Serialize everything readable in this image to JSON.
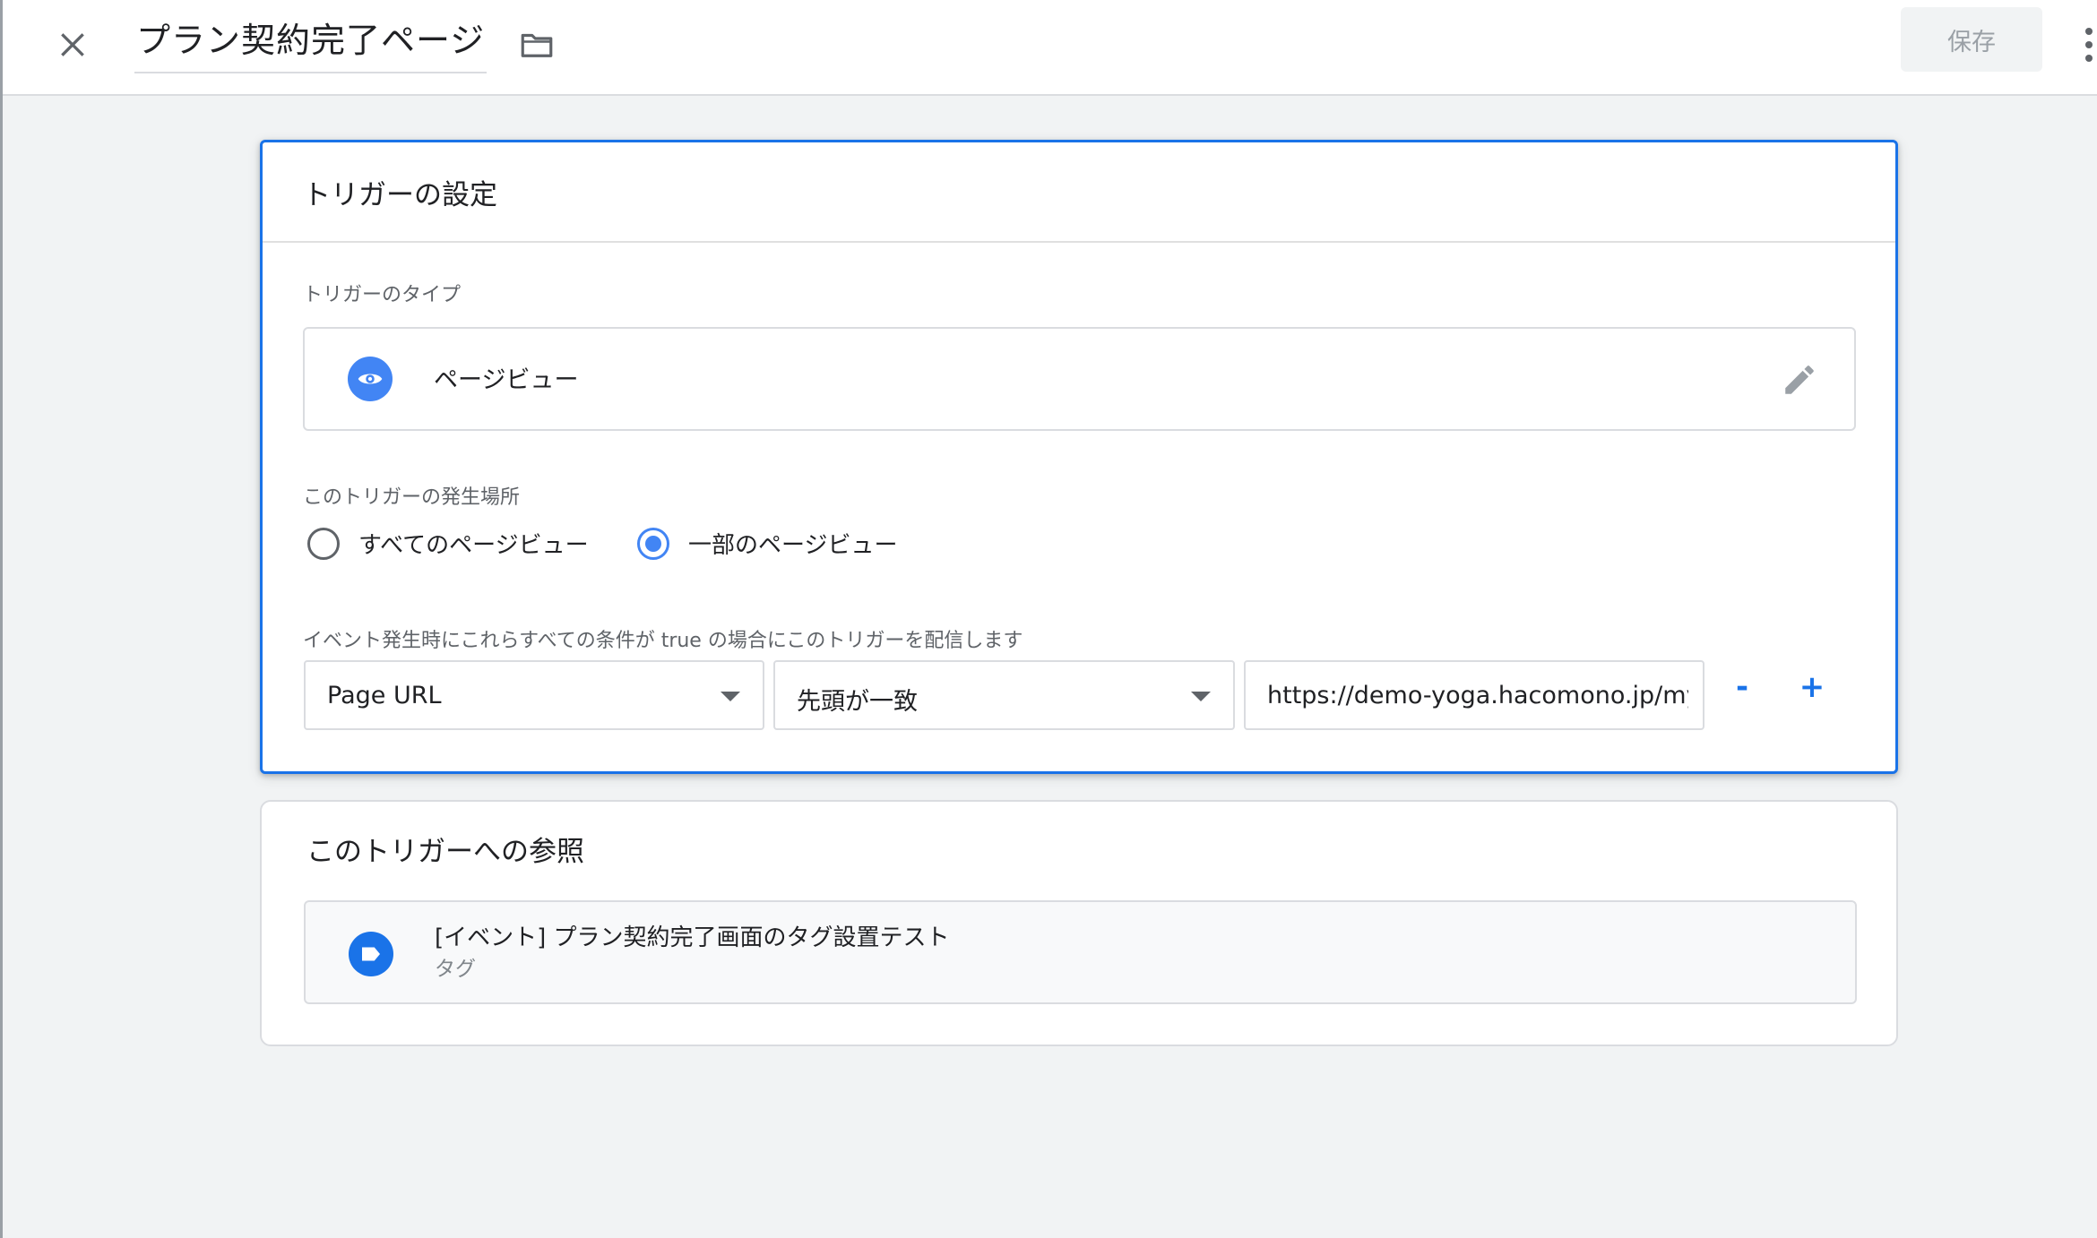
{
  "header": {
    "title": "プラン契約完了ページ",
    "save_label": "保存"
  },
  "trigger_config": {
    "card_title": "トリガーの設定",
    "type_label": "トリガーのタイプ",
    "type_name": "ページビュー",
    "fires_on_label": "このトリガーの発生場所",
    "radio_options": [
      {
        "label": "すべてのページビュー",
        "selected": false
      },
      {
        "label": "一部のページビュー",
        "selected": true
      }
    ],
    "condition_label": "イベント発生時にこれらすべての条件が true の場合にこのトリガーを配信します",
    "condition": {
      "variable": "Page URL",
      "operator": "先頭が一致",
      "value": "https://demo-yoga.hacomono.jp/myp"
    },
    "remove_label": "-",
    "add_label": "+"
  },
  "references": {
    "card_title": "このトリガーへの参照",
    "items": [
      {
        "name": "[イベント] プラン契約完了画面のタグ設置テスト",
        "kind": "タグ"
      }
    ]
  },
  "colors": {
    "accent": "#1a73e8",
    "icon_blue": "#4285f4",
    "background": "#f1f3f4"
  },
  "icons": [
    "close-icon",
    "folder-icon",
    "more-vert-icon",
    "eye-icon",
    "pencil-icon",
    "tag-icon",
    "chevron-down-icon"
  ]
}
